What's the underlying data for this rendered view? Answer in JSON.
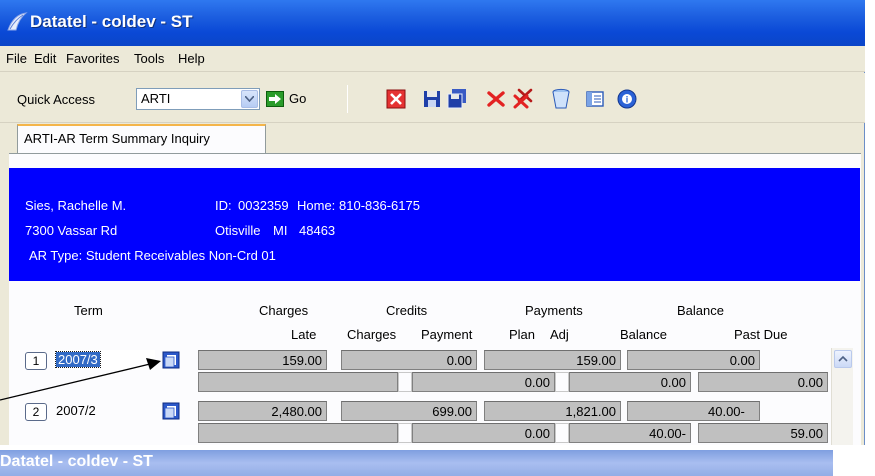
{
  "window": {
    "title": "Datatel - coldev - ST"
  },
  "menu": {
    "items": [
      "File",
      "Edit",
      "Favorites",
      "Tools",
      "Help"
    ]
  },
  "toolbar": {
    "quick_access_label": "Quick Access",
    "quick_access_value": "ARTI",
    "go_label": "Go",
    "icons": [
      "cancel-icon",
      "save-icon",
      "save-all-icon",
      "delete-icon",
      "delete-all-icon",
      "trash-icon",
      "list-icon",
      "help-icon"
    ]
  },
  "tab": {
    "label": "ARTI-AR Term Summary Inquiry"
  },
  "person": {
    "name": "Sies,  Rachelle M.",
    "id_label": "ID:",
    "id": "0032359",
    "home_label": "Home:",
    "home_phone": "810-836-6175",
    "address": "7300 Vassar Rd",
    "city": "Otisville",
    "state": "MI",
    "zip": "48463",
    "ar_type": "AR Type:  Student Receivables Non-Crd 01"
  },
  "grid": {
    "headers_top": {
      "term": "Term",
      "charges": "Charges",
      "credits": "Credits",
      "payments": "Payments",
      "balance": "Balance"
    },
    "headers_sub": {
      "late": "Late",
      "charges": "Charges",
      "payment": "Payment",
      "plan": "Plan",
      "adj": "Adj",
      "balance": "Balance",
      "past_due": "Past Due"
    },
    "rows": [
      {
        "num": "1",
        "term": "2007/3",
        "row1": {
          "charges": "159.00",
          "credits": "0.00",
          "payments": "159.00",
          "balance": "0.00"
        },
        "row2": {
          "late": "",
          "charges": "",
          "payment": "0.00",
          "plan": "",
          "adj": "0.00",
          "balance": "0.00"
        }
      },
      {
        "num": "2",
        "term": "2007/2",
        "row1": {
          "charges": "2,480.00",
          "credits": "699.00",
          "payments": "1,821.00",
          "balance": "40.00-"
        },
        "row2": {
          "late": "",
          "charges": "",
          "payment": "0.00",
          "plan": "",
          "adj": "40.00-",
          "balance": "59.00"
        }
      }
    ]
  },
  "taskbar": {
    "title": "Datatel - coldev - ST"
  },
  "colors": {
    "titlebar": "#0a49d6",
    "info_panel": "#0000ff",
    "cell": "#c0c0c0",
    "selected_term": "#316ac5"
  }
}
